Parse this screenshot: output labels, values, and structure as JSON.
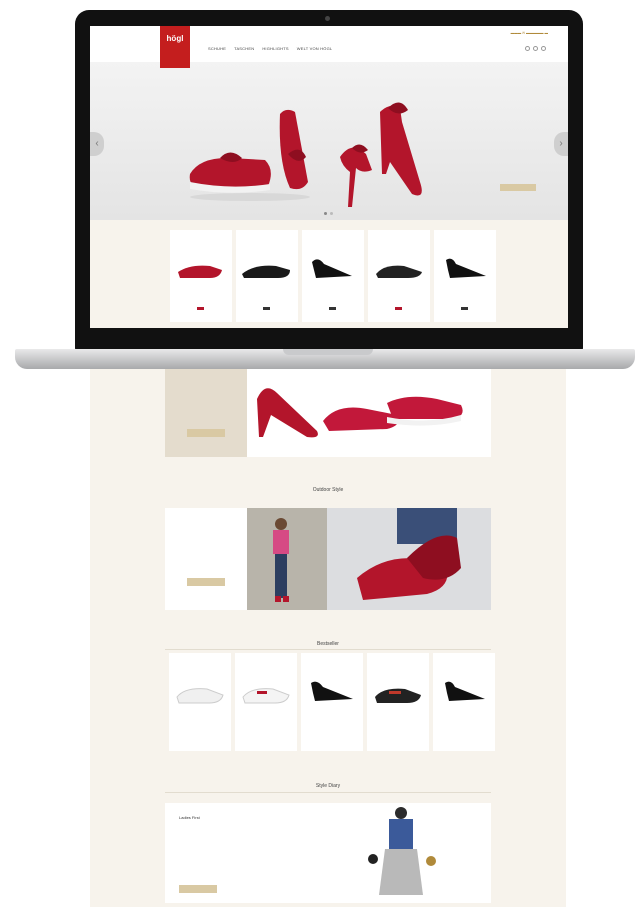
{
  "brand": {
    "logo_text": "högl",
    "accent": "#c41e1e",
    "gold": "#d9c9a3",
    "cream": "#f7f3ec"
  },
  "header": {
    "nav": [
      "SCHUHE",
      "TASCHEN",
      "HIGHLIGHTS",
      "WELT VON HÖGL"
    ],
    "icons": [
      "account-icon",
      "wishlist-icon",
      "cart-icon"
    ]
  },
  "hero": {
    "cta_label": "",
    "arrow_left": "‹",
    "arrow_right": "›"
  },
  "screen_products": [
    {
      "name": "",
      "color": "red-flat"
    },
    {
      "name": "",
      "color": "black-flat"
    },
    {
      "name": "",
      "color": "black-pump"
    },
    {
      "name": "",
      "color": "black-sneaker"
    },
    {
      "name": "",
      "color": "black-pump-2"
    }
  ],
  "sections": {
    "outdoor_title": "Outdoor Style",
    "bestseller_title": "Bestseller",
    "style_title": "Style Diary"
  },
  "style_box": {
    "heading": "Ladies First"
  }
}
